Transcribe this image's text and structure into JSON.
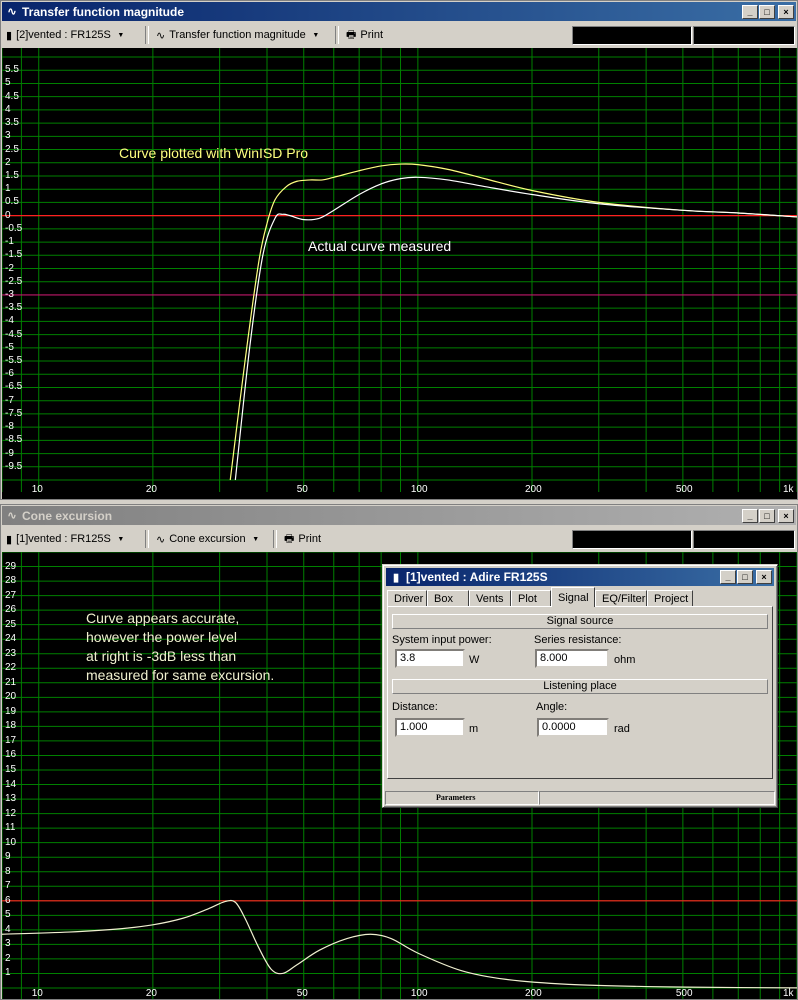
{
  "window1": {
    "title": "Transfer function magnitude",
    "icon": "curve-icon",
    "project_selector": "[2]vented : FR125S",
    "graph_selector": "Transfer function magnitude",
    "print_label": "Print",
    "annotation_yellow": "Curve plotted with WinISD Pro",
    "annotation_white": "Actual curve measured",
    "colors": {
      "yellow_curve": "#ffff80",
      "white_curve": "#ffffff",
      "red_line": "#ff2020",
      "magenta_line": "#c0186a",
      "grid": "#008000"
    }
  },
  "window2": {
    "title": "Cone excursion",
    "icon": "curve-icon",
    "project_selector": "[1]vented : FR125S",
    "graph_selector": "Cone excursion",
    "print_label": "Print",
    "annotation_lines": [
      "Curve appears accurate,",
      "however the power level",
      "at right is -3dB less than",
      "measured for same excursion."
    ],
    "colors": {
      "curve": "#f0f0d0",
      "red_line": "#ff2020",
      "grid": "#008000"
    }
  },
  "dialog": {
    "title": "[1]vented : Adire FR125S",
    "tabs": [
      "Driver",
      "Box",
      "Vents",
      "Plot",
      "Signal",
      "EQ/Filter",
      "Project"
    ],
    "active_tab": "Signal",
    "signal_source_label": "Signal source",
    "system_input_power_label": "System input power:",
    "system_input_power_value": "3.8",
    "system_input_power_unit": "W",
    "series_resistance_label": "Series resistance:",
    "series_resistance_value": "8.000",
    "series_resistance_unit": "ohm",
    "listening_place_label": "Listening place",
    "distance_label": "Distance:",
    "distance_value": "1.000",
    "distance_unit": "m",
    "angle_label": "Angle:",
    "angle_value": "0.0000",
    "angle_unit": "rad",
    "status_label": "Parameters"
  },
  "chart_data": [
    {
      "type": "line",
      "title": "Transfer function magnitude",
      "xscale": "log",
      "xlim": [
        8,
        1000
      ],
      "ylim": [
        -10,
        6
      ],
      "x_tick_labels": [
        "10",
        "20",
        "50",
        "100",
        "200",
        "500",
        "1k"
      ],
      "y_tick_labels": [
        "5.5",
        "5",
        "4.5",
        "4",
        "3.5",
        "3",
        "2.5",
        "2",
        "1.5",
        "1",
        "0.5",
        "0",
        "-0.5",
        "-1",
        "-1.5",
        "-2",
        "-2.5",
        "-3",
        "-3.5",
        "-4",
        "-4.5",
        "-5",
        "-5.5",
        "-6",
        "-6.5",
        "-7",
        "-7.5",
        "-8",
        "-8.5",
        "-9",
        "-9.5"
      ],
      "hlines": [
        {
          "y": 0,
          "color": "#ff2020"
        },
        {
          "y": -3,
          "color": "#c0186a"
        }
      ],
      "series": [
        {
          "color": "#ffff80",
          "x": [
            32,
            35,
            38,
            40,
            42,
            45,
            48,
            52,
            56,
            60,
            70,
            80,
            90,
            100,
            120,
            150,
            200,
            300,
            500,
            700,
            1000
          ],
          "y": [
            -10,
            -5.5,
            -1.8,
            -0.3,
            0.6,
            1.1,
            1.3,
            1.35,
            1.35,
            1.45,
            1.7,
            1.88,
            1.95,
            1.93,
            1.75,
            1.4,
            0.95,
            0.5,
            0.2,
            0.1,
            -0.05
          ]
        },
        {
          "color": "#ffffff",
          "x": [
            33,
            36,
            39,
            42,
            44,
            46,
            50,
            55,
            60,
            70,
            80,
            90,
            100,
            120,
            150,
            200,
            300,
            500,
            700,
            1000
          ],
          "y": [
            -10,
            -5,
            -1.5,
            -0.1,
            0.05,
            0.0,
            -0.15,
            -0.1,
            0.2,
            0.8,
            1.2,
            1.4,
            1.45,
            1.35,
            1.1,
            0.8,
            0.45,
            0.2,
            0.1,
            -0.05
          ]
        }
      ]
    },
    {
      "type": "line",
      "title": "Cone excursion",
      "xscale": "log",
      "xlim": [
        8,
        1000
      ],
      "ylim": [
        0,
        30
      ],
      "x_tick_labels": [
        "10",
        "20",
        "50",
        "100",
        "200",
        "500",
        "1k"
      ],
      "y_tick_labels": [
        "29",
        "28",
        "27",
        "26",
        "25",
        "24",
        "23",
        "22",
        "21",
        "20",
        "19",
        "18",
        "17",
        "16",
        "15",
        "14",
        "13",
        "12",
        "11",
        "10",
        "9",
        "8",
        "7",
        "6",
        "5",
        "4",
        "3",
        "2",
        "1"
      ],
      "hlines": [
        {
          "y": 6,
          "color": "#ff2020"
        }
      ],
      "series": [
        {
          "color": "#f0f0d0",
          "x": [
            8,
            12,
            16,
            20,
            24,
            28,
            31,
            33,
            35,
            38,
            41,
            44,
            48,
            55,
            65,
            75,
            85,
            100,
            130,
            170,
            250,
            400,
            700,
            1000
          ],
          "y": [
            3.7,
            3.85,
            4.05,
            4.35,
            4.8,
            5.45,
            5.95,
            5.9,
            4.8,
            2.8,
            1.3,
            1.0,
            1.6,
            2.6,
            3.4,
            3.7,
            3.4,
            2.4,
            1.2,
            0.6,
            0.25,
            0.1,
            0.03,
            0.01
          ]
        }
      ]
    }
  ]
}
